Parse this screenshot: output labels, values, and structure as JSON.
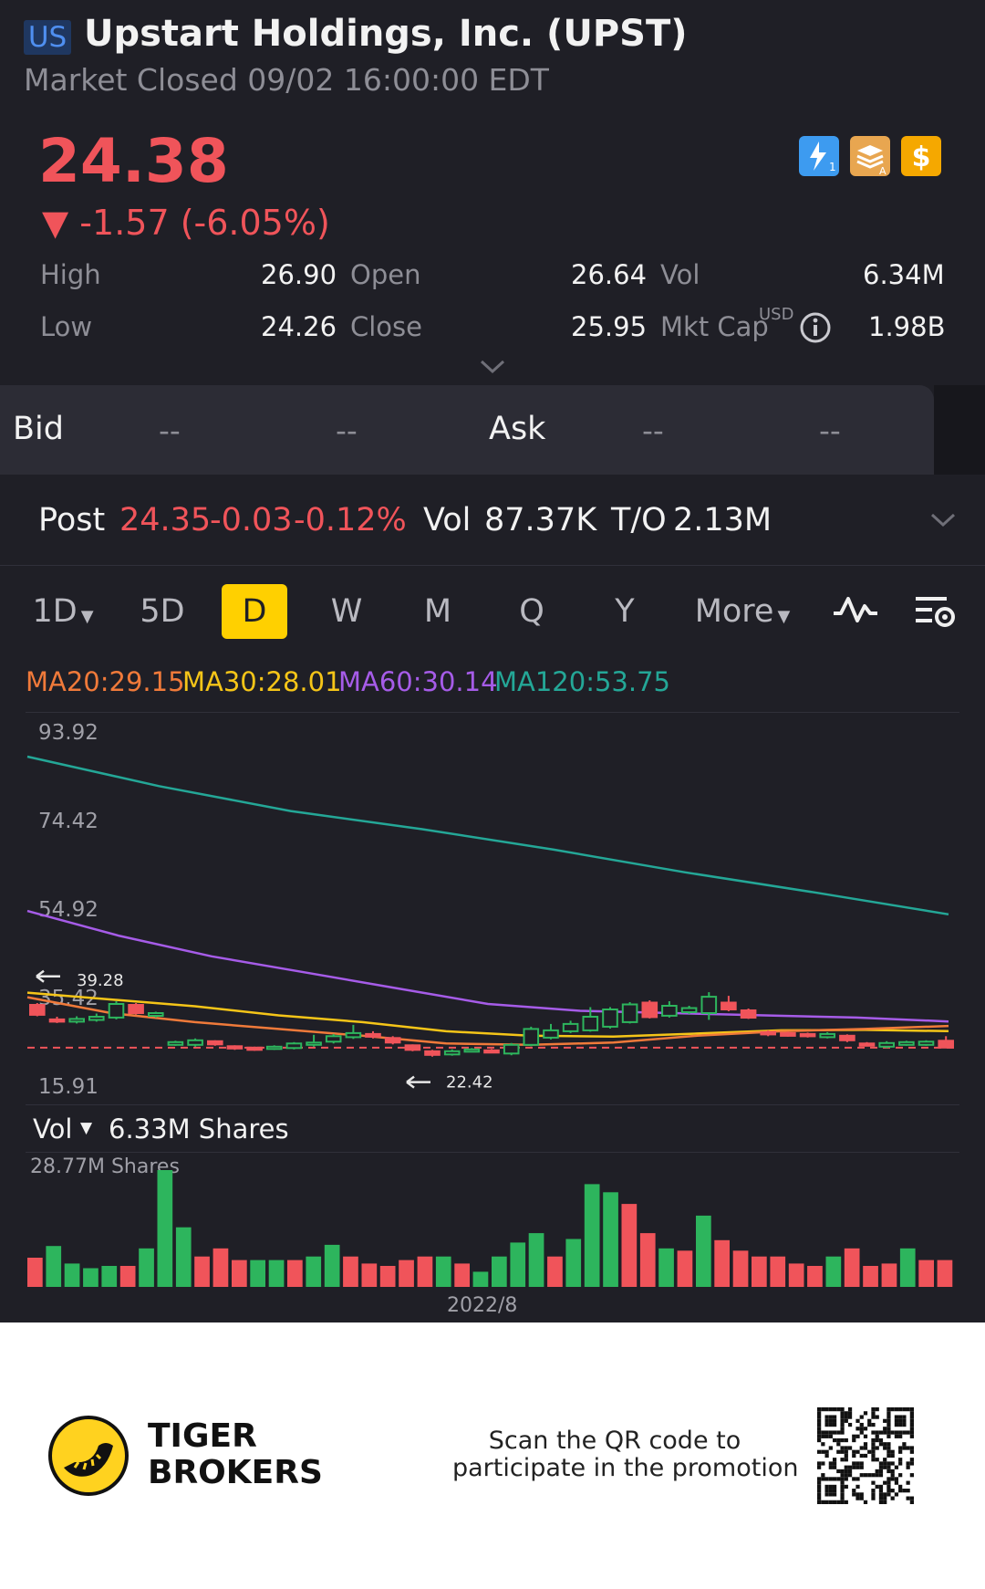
{
  "header": {
    "market_badge": "US",
    "title": "Upstart Holdings, Inc. (UPST)",
    "status": "Market Closed 09/02 16:00:00 EDT"
  },
  "quote": {
    "price": "24.38",
    "change": "▼ -1.57 (-6.05%)",
    "stats": {
      "high_label": "High",
      "high": "26.90",
      "open_label": "Open",
      "open": "26.64",
      "vol_label": "Vol",
      "vol": "6.34M",
      "low_label": "Low",
      "low": "24.26",
      "close_label": "Close",
      "close": "25.95",
      "mktcap_label": "Mkt Cap",
      "mktcap_currency": "USD",
      "mktcap": "1.98B"
    },
    "badges": [
      "lightning-1-icon",
      "stack-a-icon",
      "dollar-icon"
    ]
  },
  "bidask": {
    "bid_label": "Bid",
    "bid_price": "--",
    "bid_size": "--",
    "ask_label": "Ask",
    "ask_price": "--",
    "ask_size": "--"
  },
  "post": {
    "label": "Post",
    "price": "24.35",
    "change": "-0.03",
    "change_pct": "-0.12%",
    "vol_label": "Vol",
    "vol": "87.37K",
    "to_label": "T/O",
    "to": "2.13M"
  },
  "periods": {
    "tabs": [
      "1D",
      "5D",
      "D",
      "W",
      "M",
      "Q",
      "Y",
      "More"
    ],
    "active": "D"
  },
  "ma": {
    "ma20": "MA20:29.15",
    "ma30": "MA30:28.01",
    "ma60": "MA60:30.14",
    "ma120": "MA120:53.75"
  },
  "colors": {
    "up": "#2db55d",
    "down": "#f0545a",
    "ma20": "#f07a3a",
    "ma30": "#f5c518",
    "ma60": "#a65ce8",
    "ma120": "#24a797"
  },
  "chart_data": {
    "type": "candlestick",
    "y_ticks": [
      "93.92",
      "74.42",
      "54.92",
      "35.42",
      "15.91"
    ],
    "ylim": [
      15.91,
      93.92
    ],
    "high_marker": "39.28",
    "low_marker": "22.42",
    "last_close_line": 24.38,
    "candles": [
      {
        "o": 33.8,
        "c": 31.6,
        "h": 34.2,
        "l": 31.3
      },
      {
        "o": 30.6,
        "c": 30.1,
        "h": 31.2,
        "l": 29.8
      },
      {
        "o": 30.1,
        "c": 30.7,
        "h": 31.3,
        "l": 29.7
      },
      {
        "o": 30.5,
        "c": 31.2,
        "h": 31.9,
        "l": 30.1
      },
      {
        "o": 31.0,
        "c": 34.0,
        "h": 34.6,
        "l": 30.6
      },
      {
        "o": 33.8,
        "c": 32.0,
        "h": 34.2,
        "l": 31.7
      },
      {
        "o": 31.4,
        "c": 32.0,
        "h": 32.3,
        "l": 31.0
      },
      {
        "o": 25.0,
        "c": 25.6,
        "h": 25.9,
        "l": 24.8
      },
      {
        "o": 25.0,
        "c": 26.0,
        "h": 26.4,
        "l": 24.6
      },
      {
        "o": 25.8,
        "c": 25.1,
        "h": 26.0,
        "l": 24.8
      },
      {
        "o": 24.7,
        "c": 24.3,
        "h": 24.9,
        "l": 23.9
      },
      {
        "o": 24.4,
        "c": 24.1,
        "h": 24.6,
        "l": 23.7
      },
      {
        "o": 24.2,
        "c": 24.6,
        "h": 24.9,
        "l": 23.9
      },
      {
        "o": 24.3,
        "c": 25.3,
        "h": 25.6,
        "l": 24.0
      },
      {
        "o": 25.0,
        "c": 25.5,
        "h": 27.2,
        "l": 24.6
      },
      {
        "o": 25.7,
        "c": 26.9,
        "h": 27.4,
        "l": 25.3
      },
      {
        "o": 26.7,
        "c": 27.6,
        "h": 29.4,
        "l": 26.3
      },
      {
        "o": 27.4,
        "c": 26.8,
        "h": 28.0,
        "l": 26.4
      },
      {
        "o": 26.5,
        "c": 25.5,
        "h": 26.9,
        "l": 25.1
      },
      {
        "o": 24.9,
        "c": 23.9,
        "h": 25.1,
        "l": 23.6
      },
      {
        "o": 23.6,
        "c": 22.8,
        "h": 23.9,
        "l": 22.4
      },
      {
        "o": 22.9,
        "c": 23.6,
        "h": 24.0,
        "l": 22.6
      },
      {
        "o": 23.8,
        "c": 24.0,
        "h": 24.3,
        "l": 23.5
      },
      {
        "o": 23.8,
        "c": 23.6,
        "h": 24.1,
        "l": 23.4
      },
      {
        "o": 23.1,
        "c": 25.0,
        "h": 25.4,
        "l": 22.7
      },
      {
        "o": 25.0,
        "c": 28.5,
        "h": 29.0,
        "l": 24.7
      },
      {
        "o": 26.6,
        "c": 28.2,
        "h": 29.6,
        "l": 26.2
      },
      {
        "o": 28.0,
        "c": 29.6,
        "h": 30.3,
        "l": 27.6
      },
      {
        "o": 28.2,
        "c": 31.2,
        "h": 33.3,
        "l": 27.9
      },
      {
        "o": 29.0,
        "c": 32.8,
        "h": 33.3,
        "l": 28.6
      },
      {
        "o": 30.0,
        "c": 33.9,
        "h": 34.4,
        "l": 29.7
      },
      {
        "o": 34.3,
        "c": 31.1,
        "h": 34.8,
        "l": 30.8
      },
      {
        "o": 31.4,
        "c": 33.6,
        "h": 34.6,
        "l": 31.0
      },
      {
        "o": 32.2,
        "c": 33.1,
        "h": 33.6,
        "l": 31.8
      },
      {
        "o": 32.0,
        "c": 35.6,
        "h": 36.6,
        "l": 30.5
      },
      {
        "o": 34.3,
        "c": 32.8,
        "h": 35.8,
        "l": 32.4
      },
      {
        "o": 32.6,
        "c": 31.0,
        "h": 33.0,
        "l": 30.7
      },
      {
        "o": 27.8,
        "c": 27.3,
        "h": 28.2,
        "l": 26.9
      },
      {
        "o": 27.6,
        "c": 27.0,
        "h": 27.9,
        "l": 26.8
      },
      {
        "o": 27.4,
        "c": 26.9,
        "h": 27.7,
        "l": 26.6
      },
      {
        "o": 26.7,
        "c": 27.4,
        "h": 27.8,
        "l": 26.4
      },
      {
        "o": 27.0,
        "c": 26.0,
        "h": 27.3,
        "l": 25.6
      },
      {
        "o": 25.3,
        "c": 25.0,
        "h": 25.6,
        "l": 24.7
      },
      {
        "o": 24.6,
        "c": 25.4,
        "h": 25.8,
        "l": 24.3
      },
      {
        "o": 25.0,
        "c": 25.6,
        "h": 25.9,
        "l": 24.8
      },
      {
        "o": 25.0,
        "c": 25.7,
        "h": 26.0,
        "l": 24.8
      },
      {
        "o": 25.9,
        "c": 24.4,
        "h": 26.9,
        "l": 24.3
      }
    ],
    "ma120": [
      88.5,
      82.0,
      76.5,
      72.5,
      68.0,
      63.0,
      58.5,
      53.75
    ],
    "ma60": [
      54.5,
      49.0,
      44.5,
      41.0,
      37.5,
      34.0,
      32.5,
      32.0,
      31.5,
      31.0,
      30.14
    ],
    "ma30": [
      36.5,
      35.0,
      33.5,
      31.5,
      30.0,
      28.0,
      27.0,
      26.8,
      27.5,
      28.2,
      28.3,
      28.01
    ],
    "ma20": [
      35.5,
      32.0,
      30.0,
      28.5,
      27.0,
      25.3,
      25.0,
      25.5,
      27.0,
      28.0,
      28.5,
      29.15
    ]
  },
  "volume": {
    "label": "Vol",
    "value": "6.33M Shares",
    "max_label": "28.77M Shares",
    "date_label": "2022/8",
    "bars": [
      {
        "v": 0.25,
        "up": false
      },
      {
        "v": 0.35,
        "up": true
      },
      {
        "v": 0.2,
        "up": true
      },
      {
        "v": 0.16,
        "up": true
      },
      {
        "v": 0.18,
        "up": true
      },
      {
        "v": 0.18,
        "up": false
      },
      {
        "v": 0.33,
        "up": true
      },
      {
        "v": 1.0,
        "up": true
      },
      {
        "v": 0.51,
        "up": true
      },
      {
        "v": 0.26,
        "up": false
      },
      {
        "v": 0.33,
        "up": false
      },
      {
        "v": 0.23,
        "up": false
      },
      {
        "v": 0.23,
        "up": true
      },
      {
        "v": 0.23,
        "up": true
      },
      {
        "v": 0.23,
        "up": false
      },
      {
        "v": 0.26,
        "up": true
      },
      {
        "v": 0.36,
        "up": true
      },
      {
        "v": 0.26,
        "up": false
      },
      {
        "v": 0.2,
        "up": false
      },
      {
        "v": 0.18,
        "up": false
      },
      {
        "v": 0.23,
        "up": false
      },
      {
        "v": 0.26,
        "up": false
      },
      {
        "v": 0.26,
        "up": true
      },
      {
        "v": 0.2,
        "up": false
      },
      {
        "v": 0.13,
        "up": true
      },
      {
        "v": 0.26,
        "up": true
      },
      {
        "v": 0.38,
        "up": true
      },
      {
        "v": 0.46,
        "up": true
      },
      {
        "v": 0.26,
        "up": false
      },
      {
        "v": 0.41,
        "up": true
      },
      {
        "v": 0.88,
        "up": true
      },
      {
        "v": 0.81,
        "up": true
      },
      {
        "v": 0.71,
        "up": false
      },
      {
        "v": 0.46,
        "up": false
      },
      {
        "v": 0.33,
        "up": true
      },
      {
        "v": 0.31,
        "up": false
      },
      {
        "v": 0.61,
        "up": true
      },
      {
        "v": 0.4,
        "up": false
      },
      {
        "v": 0.31,
        "up": false
      },
      {
        "v": 0.26,
        "up": false
      },
      {
        "v": 0.26,
        "up": false
      },
      {
        "v": 0.2,
        "up": false
      },
      {
        "v": 0.18,
        "up": false
      },
      {
        "v": 0.26,
        "up": true
      },
      {
        "v": 0.33,
        "up": false
      },
      {
        "v": 0.18,
        "up": false
      },
      {
        "v": 0.2,
        "up": false
      },
      {
        "v": 0.33,
        "up": true
      },
      {
        "v": 0.23,
        "up": false
      },
      {
        "v": 0.23,
        "up": false
      }
    ]
  },
  "footer": {
    "brand_line1": "TIGER",
    "brand_line2": "BROKERS",
    "promo_line1": "Scan the QR code to",
    "promo_line2": "participate in the promotion"
  }
}
